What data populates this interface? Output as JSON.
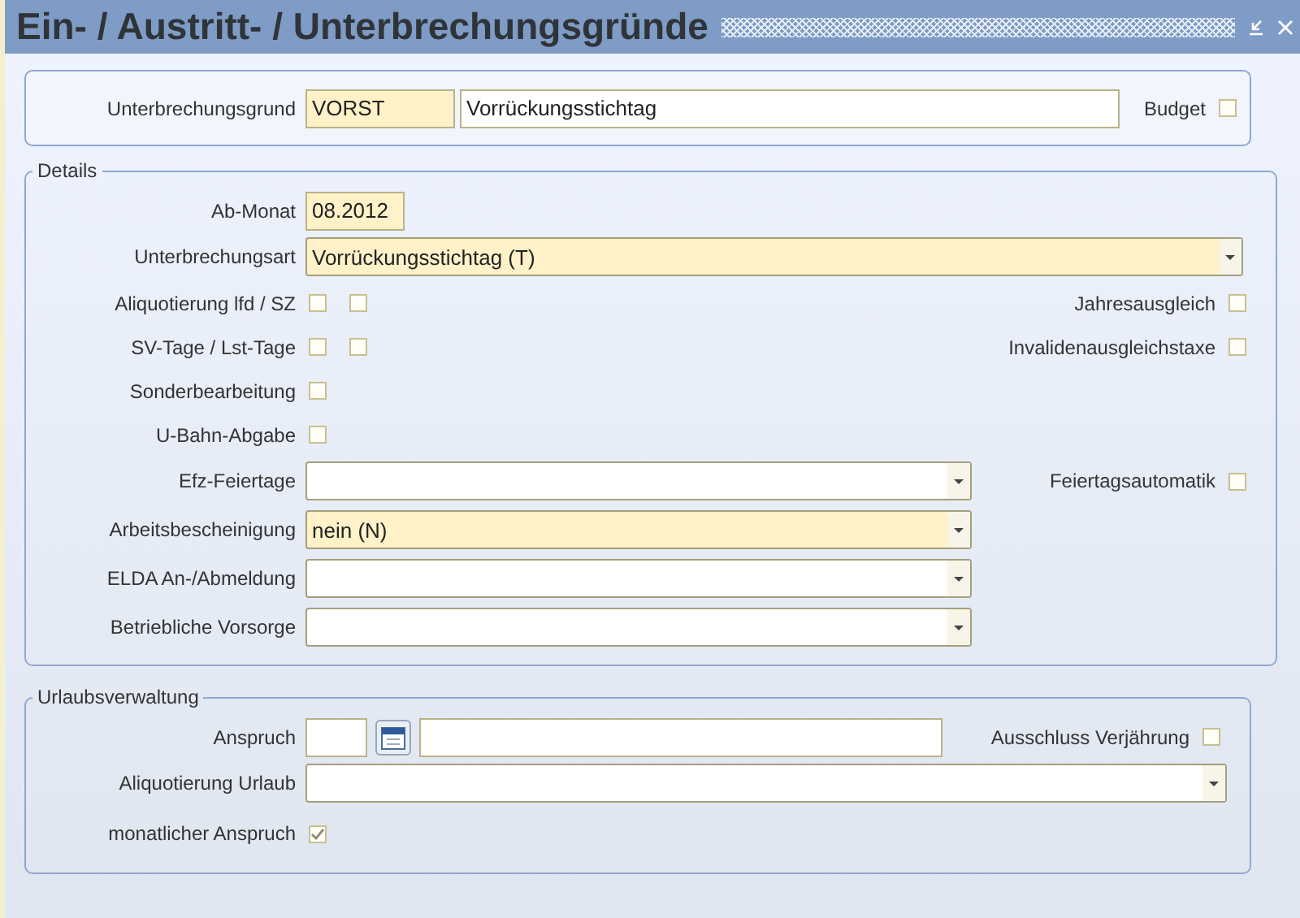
{
  "window": {
    "title": "Ein- / Austritt- / Unterbrechungsgründe"
  },
  "header": {
    "label": "Unterbrechungsgrund",
    "code": "VORST",
    "description": "Vorrückungsstichtag",
    "budget": {
      "label": "Budget",
      "checked": false
    }
  },
  "details": {
    "legend": "Details",
    "rows": [
      {
        "kind": "text",
        "label": "Ab-Monat",
        "value": "08.2012",
        "required": true
      },
      {
        "kind": "select",
        "label": "Unterbrechungsart",
        "value": "Vorrückungsstichtag (T)",
        "required": true,
        "wide": true
      },
      {
        "kind": "checks",
        "label": "Aliquotierung lfd / SZ",
        "checks": [
          {
            "checked": false
          },
          {
            "checked": false
          }
        ],
        "right": {
          "label": "Jahresausgleich",
          "checked": false
        }
      },
      {
        "kind": "checks",
        "label": "SV-Tage / Lst-Tage",
        "checks": [
          {
            "checked": false
          },
          {
            "checked": false
          }
        ],
        "right": {
          "label": "Invalidenausgleichstaxe",
          "checked": false
        }
      },
      {
        "kind": "checks",
        "label": "Sonderbearbeitung",
        "checks": [
          {
            "checked": false
          }
        ]
      },
      {
        "kind": "checks",
        "label": "U-Bahn-Abgabe",
        "checks": [
          {
            "checked": false
          }
        ]
      },
      {
        "kind": "select",
        "label": "Efz-Feiertage",
        "required": false,
        "wide": false,
        "right": {
          "label": "Feiertagsautomatik",
          "checked": false
        }
      },
      {
        "kind": "select",
        "label": "Arbeitsbescheinigung",
        "value": "nein (N)",
        "required": true,
        "wide": false
      },
      {
        "kind": "select",
        "label": "ELDA An-/Abmeldung",
        "required": false,
        "wide": false
      },
      {
        "kind": "select",
        "label": "Betriebliche Vorsorge",
        "required": false,
        "wide": false
      }
    ]
  },
  "vacation": {
    "legend": "Urlaubsverwaltung",
    "claim": {
      "label": "Anspruch",
      "right": {
        "label": "Ausschluss Verjährung",
        "checked": false
      }
    },
    "aliquot": {
      "label": "Aliquotierung Urlaub"
    },
    "monthly": {
      "label": "monatlicher Anspruch",
      "checked": true
    }
  }
}
